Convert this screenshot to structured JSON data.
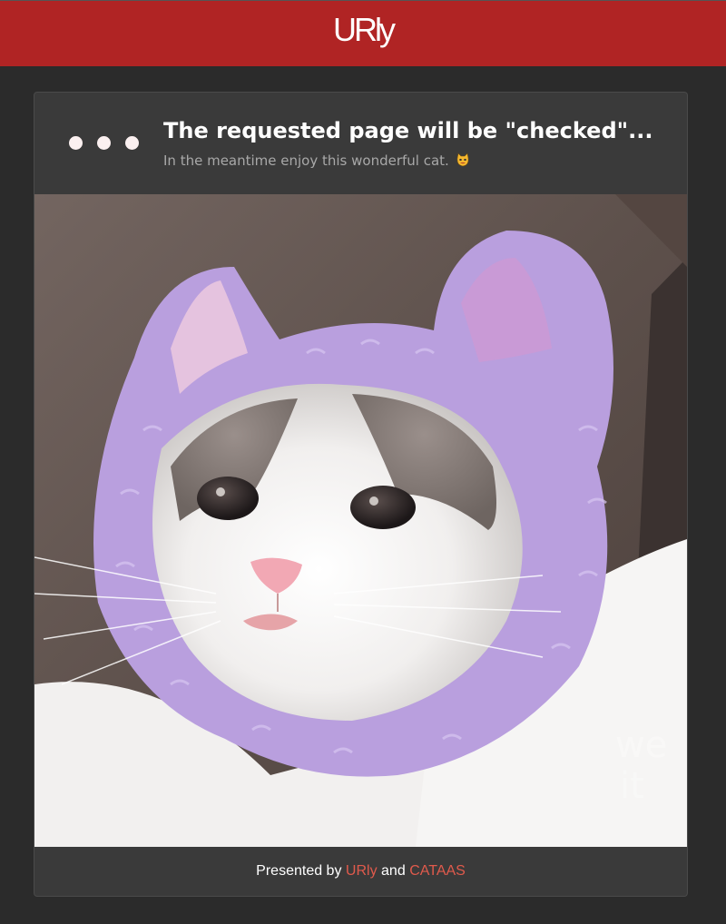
{
  "header": {
    "logo": "URly",
    "brand_color": "#b02424"
  },
  "card": {
    "title": "The requested page will be \"checked\"...",
    "subtitle": "In the meantime enjoy this wonderful cat.",
    "subtitle_emoji": "cat-emoji-icon",
    "loading_dots": 3,
    "image": {
      "alt": "cat wearing purple fluffy ear hat"
    }
  },
  "footer": {
    "prefix": "Presented by",
    "link1": "URly",
    "conjunction": "and",
    "link2": "CATAAS",
    "link_color": "#e05a4c"
  }
}
